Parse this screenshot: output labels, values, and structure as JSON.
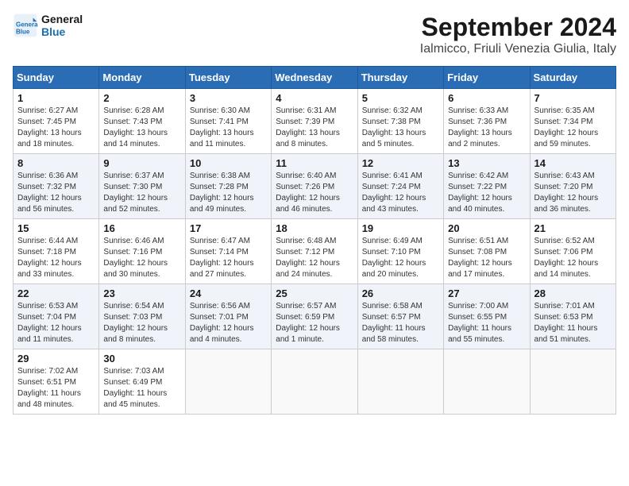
{
  "logo": {
    "line1": "General",
    "line2": "Blue"
  },
  "title": "September 2024",
  "location": "Ialmicco, Friuli Venezia Giulia, Italy",
  "days_header": [
    "Sunday",
    "Monday",
    "Tuesday",
    "Wednesday",
    "Thursday",
    "Friday",
    "Saturday"
  ],
  "weeks": [
    [
      {
        "day": "1",
        "info": "Sunrise: 6:27 AM\nSunset: 7:45 PM\nDaylight: 13 hours\nand 18 minutes."
      },
      {
        "day": "2",
        "info": "Sunrise: 6:28 AM\nSunset: 7:43 PM\nDaylight: 13 hours\nand 14 minutes."
      },
      {
        "day": "3",
        "info": "Sunrise: 6:30 AM\nSunset: 7:41 PM\nDaylight: 13 hours\nand 11 minutes."
      },
      {
        "day": "4",
        "info": "Sunrise: 6:31 AM\nSunset: 7:39 PM\nDaylight: 13 hours\nand 8 minutes."
      },
      {
        "day": "5",
        "info": "Sunrise: 6:32 AM\nSunset: 7:38 PM\nDaylight: 13 hours\nand 5 minutes."
      },
      {
        "day": "6",
        "info": "Sunrise: 6:33 AM\nSunset: 7:36 PM\nDaylight: 13 hours\nand 2 minutes."
      },
      {
        "day": "7",
        "info": "Sunrise: 6:35 AM\nSunset: 7:34 PM\nDaylight: 12 hours\nand 59 minutes."
      }
    ],
    [
      {
        "day": "8",
        "info": "Sunrise: 6:36 AM\nSunset: 7:32 PM\nDaylight: 12 hours\nand 56 minutes."
      },
      {
        "day": "9",
        "info": "Sunrise: 6:37 AM\nSunset: 7:30 PM\nDaylight: 12 hours\nand 52 minutes."
      },
      {
        "day": "10",
        "info": "Sunrise: 6:38 AM\nSunset: 7:28 PM\nDaylight: 12 hours\nand 49 minutes."
      },
      {
        "day": "11",
        "info": "Sunrise: 6:40 AM\nSunset: 7:26 PM\nDaylight: 12 hours\nand 46 minutes."
      },
      {
        "day": "12",
        "info": "Sunrise: 6:41 AM\nSunset: 7:24 PM\nDaylight: 12 hours\nand 43 minutes."
      },
      {
        "day": "13",
        "info": "Sunrise: 6:42 AM\nSunset: 7:22 PM\nDaylight: 12 hours\nand 40 minutes."
      },
      {
        "day": "14",
        "info": "Sunrise: 6:43 AM\nSunset: 7:20 PM\nDaylight: 12 hours\nand 36 minutes."
      }
    ],
    [
      {
        "day": "15",
        "info": "Sunrise: 6:44 AM\nSunset: 7:18 PM\nDaylight: 12 hours\nand 33 minutes."
      },
      {
        "day": "16",
        "info": "Sunrise: 6:46 AM\nSunset: 7:16 PM\nDaylight: 12 hours\nand 30 minutes."
      },
      {
        "day": "17",
        "info": "Sunrise: 6:47 AM\nSunset: 7:14 PM\nDaylight: 12 hours\nand 27 minutes."
      },
      {
        "day": "18",
        "info": "Sunrise: 6:48 AM\nSunset: 7:12 PM\nDaylight: 12 hours\nand 24 minutes."
      },
      {
        "day": "19",
        "info": "Sunrise: 6:49 AM\nSunset: 7:10 PM\nDaylight: 12 hours\nand 20 minutes."
      },
      {
        "day": "20",
        "info": "Sunrise: 6:51 AM\nSunset: 7:08 PM\nDaylight: 12 hours\nand 17 minutes."
      },
      {
        "day": "21",
        "info": "Sunrise: 6:52 AM\nSunset: 7:06 PM\nDaylight: 12 hours\nand 14 minutes."
      }
    ],
    [
      {
        "day": "22",
        "info": "Sunrise: 6:53 AM\nSunset: 7:04 PM\nDaylight: 12 hours\nand 11 minutes."
      },
      {
        "day": "23",
        "info": "Sunrise: 6:54 AM\nSunset: 7:03 PM\nDaylight: 12 hours\nand 8 minutes."
      },
      {
        "day": "24",
        "info": "Sunrise: 6:56 AM\nSunset: 7:01 PM\nDaylight: 12 hours\nand 4 minutes."
      },
      {
        "day": "25",
        "info": "Sunrise: 6:57 AM\nSunset: 6:59 PM\nDaylight: 12 hours\nand 1 minute."
      },
      {
        "day": "26",
        "info": "Sunrise: 6:58 AM\nSunset: 6:57 PM\nDaylight: 11 hours\nand 58 minutes."
      },
      {
        "day": "27",
        "info": "Sunrise: 7:00 AM\nSunset: 6:55 PM\nDaylight: 11 hours\nand 55 minutes."
      },
      {
        "day": "28",
        "info": "Sunrise: 7:01 AM\nSunset: 6:53 PM\nDaylight: 11 hours\nand 51 minutes."
      }
    ],
    [
      {
        "day": "29",
        "info": "Sunrise: 7:02 AM\nSunset: 6:51 PM\nDaylight: 11 hours\nand 48 minutes."
      },
      {
        "day": "30",
        "info": "Sunrise: 7:03 AM\nSunset: 6:49 PM\nDaylight: 11 hours\nand 45 minutes."
      },
      {
        "day": "",
        "info": ""
      },
      {
        "day": "",
        "info": ""
      },
      {
        "day": "",
        "info": ""
      },
      {
        "day": "",
        "info": ""
      },
      {
        "day": "",
        "info": ""
      }
    ]
  ]
}
